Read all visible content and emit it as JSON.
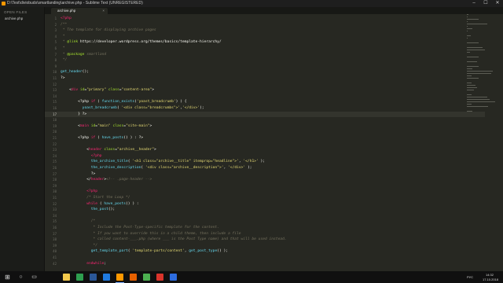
{
  "window": {
    "title": "D:\\Test\\diviobuds\\smartlanding\\archive.php - Sublime Text (UNREGISTERED)",
    "controls": {
      "minimize": "–",
      "maximize": "☐",
      "close": "✕"
    }
  },
  "sidebar": {
    "header": "OPEN FILES",
    "files": [
      "archive.php"
    ]
  },
  "tabs": [
    {
      "label": "archive.php",
      "close": "×"
    }
  ],
  "colors": {
    "tag": "#f92672",
    "attr": "#a6e22e",
    "string": "#e6db74",
    "function": "#66d9ef",
    "comment": "#75715e",
    "keyword": "#f92672",
    "plain": "#f8f8f2",
    "editor_bg": "#272822"
  },
  "editor": {
    "current_line": 17,
    "lines": [
      {
        "n": 1,
        "t": [
          [
            "tag",
            "<?php"
          ]
        ]
      },
      {
        "n": 2,
        "t": [
          [
            "comment",
            "/**"
          ]
        ]
      },
      {
        "n": 3,
        "t": [
          [
            "comment",
            " * The template for displaying archive pages"
          ]
        ]
      },
      {
        "n": 4,
        "t": [
          [
            "comment",
            " *"
          ]
        ]
      },
      {
        "n": 5,
        "t": [
          [
            "comment",
            " * "
          ],
          [
            "attr",
            "@link"
          ],
          [
            "plain",
            " https://developer.wordpress.org/themes/basics/template-hierarchy/"
          ]
        ]
      },
      {
        "n": 6,
        "t": [
          [
            "comment",
            " *"
          ]
        ]
      },
      {
        "n": 7,
        "t": [
          [
            "comment",
            " * "
          ],
          [
            "attr",
            "@package"
          ],
          [
            "comment",
            " smartland"
          ]
        ]
      },
      {
        "n": 8,
        "t": [
          [
            "comment",
            " */"
          ]
        ]
      },
      {
        "n": 9,
        "t": []
      },
      {
        "n": 10,
        "t": [
          [
            "function",
            "get_header"
          ],
          [
            "plain",
            "();"
          ]
        ]
      },
      {
        "n": 11,
        "t": [
          [
            "plain",
            "?>"
          ]
        ]
      },
      {
        "n": 12,
        "t": []
      },
      {
        "n": 13,
        "t": [
          [
            "plain",
            "    <"
          ],
          [
            "tag",
            "div"
          ],
          [
            "attr",
            " id"
          ],
          [
            "plain",
            "="
          ],
          [
            "string",
            "\"primary\""
          ],
          [
            "attr",
            " class"
          ],
          [
            "plain",
            "="
          ],
          [
            "string",
            "\"content-area\""
          ],
          [
            "plain",
            ">"
          ]
        ]
      },
      {
        "n": 14,
        "t": []
      },
      {
        "n": 15,
        "t": [
          [
            "plain",
            "        <?php "
          ],
          [
            "keyword",
            "if"
          ],
          [
            "plain",
            " ( "
          ],
          [
            "function",
            "function_exists"
          ],
          [
            "plain",
            "("
          ],
          [
            "string",
            "'yoast_breadcrumb'"
          ],
          [
            "plain",
            ") ) {"
          ]
        ]
      },
      {
        "n": 16,
        "t": [
          [
            "plain",
            "          "
          ],
          [
            "function",
            "yoast_breadcrumb"
          ],
          [
            "plain",
            "( "
          ],
          [
            "string",
            "'<div class=\"breadcrumbs\">'"
          ],
          [
            "plain",
            ","
          ],
          [
            "string",
            "'</div>'"
          ],
          [
            "plain",
            ");"
          ]
        ]
      },
      {
        "n": 17,
        "t": [
          [
            "plain",
            "        } ?>"
          ]
        ]
      },
      {
        "n": 18,
        "t": []
      },
      {
        "n": 19,
        "t": [
          [
            "plain",
            "        <"
          ],
          [
            "tag",
            "main"
          ],
          [
            "attr",
            " id"
          ],
          [
            "plain",
            "="
          ],
          [
            "string",
            "\"main\""
          ],
          [
            "attr",
            " class"
          ],
          [
            "plain",
            "="
          ],
          [
            "string",
            "\"site-main\""
          ],
          [
            "plain",
            ">"
          ]
        ]
      },
      {
        "n": 20,
        "t": []
      },
      {
        "n": 21,
        "t": [
          [
            "plain",
            "        <?php "
          ],
          [
            "keyword",
            "if"
          ],
          [
            "plain",
            " ( "
          ],
          [
            "function",
            "have_posts"
          ],
          [
            "plain",
            "() ) : ?>"
          ]
        ]
      },
      {
        "n": 22,
        "t": []
      },
      {
        "n": 23,
        "t": [
          [
            "plain",
            "            <"
          ],
          [
            "tag",
            "header"
          ],
          [
            "attr",
            " class"
          ],
          [
            "plain",
            "="
          ],
          [
            "string",
            "\"archive__header\""
          ],
          [
            "plain",
            ">"
          ]
        ]
      },
      {
        "n": 24,
        "t": [
          [
            "plain",
            "              "
          ],
          [
            "tag",
            "<?php"
          ]
        ]
      },
      {
        "n": 25,
        "t": [
          [
            "plain",
            "              "
          ],
          [
            "function",
            "the_archive_title"
          ],
          [
            "plain",
            "( "
          ],
          [
            "string",
            "'<h1 class=\"archive__title\" itemprop=\"headline\">'"
          ],
          [
            "plain",
            ", "
          ],
          [
            "string",
            "'</h1>'"
          ],
          [
            "plain",
            " );"
          ]
        ]
      },
      {
        "n": 26,
        "t": [
          [
            "plain",
            "              "
          ],
          [
            "function",
            "the_archive_description"
          ],
          [
            "plain",
            "( "
          ],
          [
            "string",
            "'<div class=\"archive__description\">'"
          ],
          [
            "plain",
            ", "
          ],
          [
            "string",
            "'</div>'"
          ],
          [
            "plain",
            " );"
          ]
        ]
      },
      {
        "n": 27,
        "t": [
          [
            "plain",
            "              ?>"
          ]
        ]
      },
      {
        "n": 28,
        "t": [
          [
            "plain",
            "            </"
          ],
          [
            "tag",
            "header"
          ],
          [
            "plain",
            ">"
          ],
          [
            "comment",
            "<!-- .page-header -->"
          ]
        ]
      },
      {
        "n": 29,
        "t": []
      },
      {
        "n": 30,
        "t": [
          [
            "plain",
            "            "
          ],
          [
            "tag",
            "<?php"
          ]
        ]
      },
      {
        "n": 31,
        "t": [
          [
            "comment",
            "            /* Start the Loop */"
          ]
        ]
      },
      {
        "n": 32,
        "t": [
          [
            "plain",
            "            "
          ],
          [
            "keyword",
            "while"
          ],
          [
            "plain",
            " ( "
          ],
          [
            "function",
            "have_posts"
          ],
          [
            "plain",
            "() ) :"
          ]
        ]
      },
      {
        "n": 33,
        "t": [
          [
            "plain",
            "              "
          ],
          [
            "function",
            "the_post"
          ],
          [
            "plain",
            "();"
          ]
        ]
      },
      {
        "n": 34,
        "t": []
      },
      {
        "n": 35,
        "t": [
          [
            "comment",
            "              /*"
          ]
        ]
      },
      {
        "n": 36,
        "t": [
          [
            "comment",
            "               * Include the Post-Type-specific template for the content."
          ]
        ]
      },
      {
        "n": 37,
        "t": [
          [
            "comment",
            "               * If you want to override this in a child theme, then include a file"
          ]
        ]
      },
      {
        "n": 38,
        "t": [
          [
            "comment",
            "               * called content-___.php (where ___ is the Post Type name) and that will be used instead."
          ]
        ]
      },
      {
        "n": 39,
        "t": [
          [
            "comment",
            "               */"
          ]
        ]
      },
      {
        "n": 40,
        "t": [
          [
            "plain",
            "              "
          ],
          [
            "function",
            "get_template_part"
          ],
          [
            "plain",
            "( "
          ],
          [
            "string",
            "'template-parts/content'"
          ],
          [
            "plain",
            ", "
          ],
          [
            "function",
            "get_post_type"
          ],
          [
            "plain",
            "() );"
          ]
        ]
      },
      {
        "n": 41,
        "t": []
      },
      {
        "n": 42,
        "t": [
          [
            "plain",
            "            "
          ],
          [
            "keyword",
            "endwhile"
          ],
          [
            "plain",
            ";"
          ]
        ]
      }
    ]
  },
  "taskbar": {
    "start": "⊞",
    "search": "○",
    "taskview": "▭",
    "apps": [
      {
        "name": "file-explorer",
        "color": "#f2c94c"
      },
      {
        "name": "green-app",
        "color": "#2e9e4f"
      },
      {
        "name": "word",
        "color": "#2b5797"
      },
      {
        "name": "media-app",
        "color": "#1f7ae0"
      },
      {
        "name": "sublime-text",
        "color": "#ff9800"
      },
      {
        "name": "firefox",
        "color": "#e66000"
      },
      {
        "name": "chrome",
        "color": "#4caf50"
      },
      {
        "name": "red-app",
        "color": "#d9342b"
      },
      {
        "name": "blue-app",
        "color": "#2d6cdf"
      }
    ],
    "tray": {
      "lang": "РУС",
      "time": "14:32",
      "date": "17.10.2018"
    }
  }
}
